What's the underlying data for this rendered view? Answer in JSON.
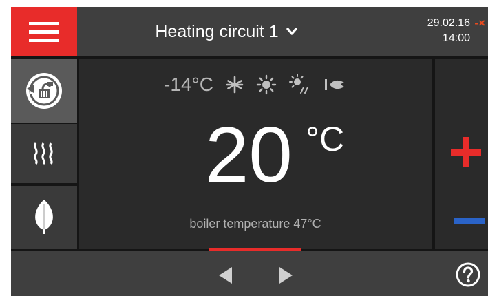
{
  "header": {
    "title": "Heating circuit 1",
    "date": "29.02.16",
    "time": "14:00",
    "error_mark": "-×"
  },
  "status": {
    "outdoor_temp": "-14°C"
  },
  "main": {
    "setpoint_value": "20",
    "setpoint_unit": "°C",
    "boiler_text": "boiler temperature 47°C"
  },
  "icons": {
    "menu": "hamburger-menu-icon",
    "dropdown": "chevron-down-icon",
    "mode": "auto-mode-icon",
    "heating": "heating-waves-icon",
    "eco": "leaf-icon",
    "winter": "snowflake-icon",
    "summer": "sun-icon",
    "transition": "sun-rain-icon",
    "burner": "burner-flame-icon",
    "increase": "plus-icon",
    "decrease": "minus-icon",
    "prev": "arrow-left-icon",
    "next": "arrow-right-icon",
    "help": "help-icon"
  },
  "colors": {
    "accent_red": "#e82c2a",
    "decrease_blue": "#2a63c8",
    "panel_dark": "#2a2a2a",
    "panel_mid": "#3f3f3f"
  }
}
